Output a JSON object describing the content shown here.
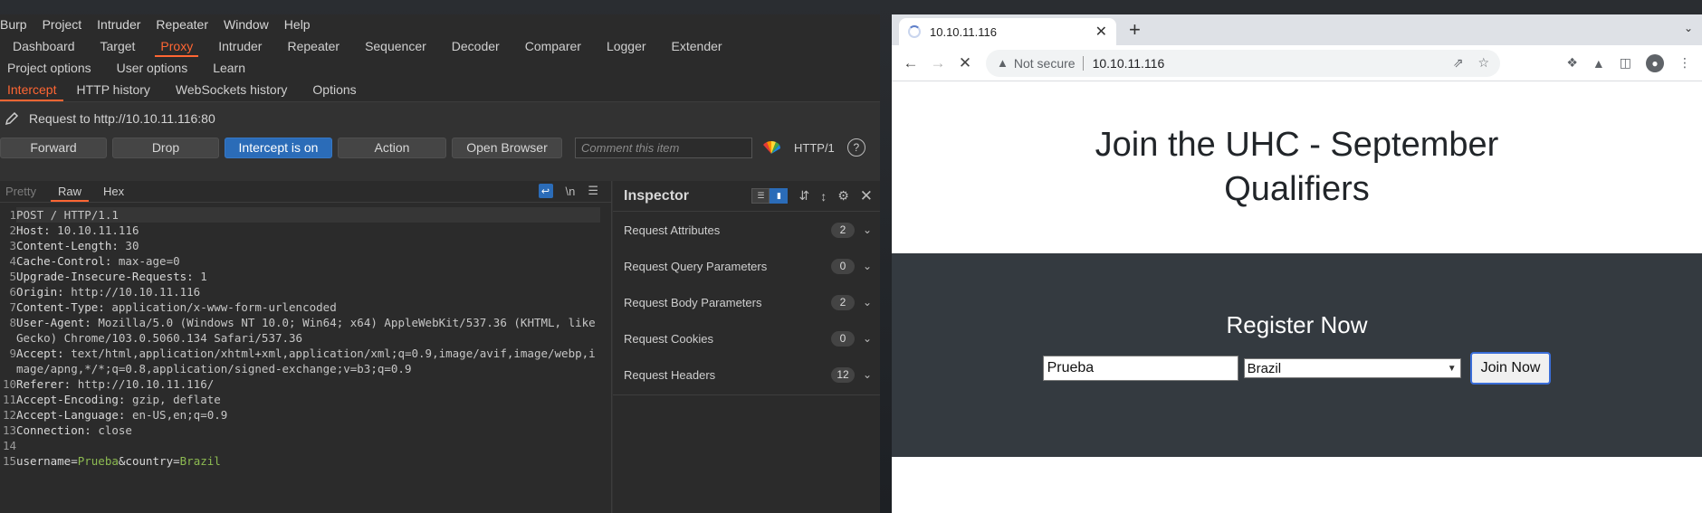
{
  "burp": {
    "menu": [
      "Burp",
      "Project",
      "Intruder",
      "Repeater",
      "Window",
      "Help"
    ],
    "tabs": [
      "Dashboard",
      "Target",
      "Proxy",
      "Intruder",
      "Repeater",
      "Sequencer",
      "Decoder",
      "Comparer",
      "Logger",
      "Extender"
    ],
    "tabs2": [
      "Project options",
      "User options",
      "Learn"
    ],
    "subtabs": [
      "Intercept",
      "HTTP history",
      "WebSockets history",
      "Options"
    ],
    "request_to": "Request to http://10.10.11.116:80",
    "buttons": {
      "forward": "Forward",
      "drop": "Drop",
      "intercept": "Intercept is on",
      "action": "Action",
      "open_browser": "Open Browser"
    },
    "comment_placeholder": "Comment this item",
    "http_version": "HTTP/1",
    "editor_tabs": [
      "Pretty",
      "Raw",
      "Hex"
    ],
    "newline_label": "\\n",
    "lines": [
      {
        "no": "1",
        "text": "POST / HTTP/1.1"
      },
      {
        "no": "2",
        "key": "Host:",
        "val": " 10.10.11.116"
      },
      {
        "no": "3",
        "key": "Content-Length:",
        "val": " 30"
      },
      {
        "no": "4",
        "key": "Cache-Control:",
        "val": " max-age=0"
      },
      {
        "no": "5",
        "key": "Upgrade-Insecure-Requests:",
        "val": " 1"
      },
      {
        "no": "6",
        "key": "Origin:",
        "val": " http://10.10.11.116"
      },
      {
        "no": "7",
        "key": "Content-Type:",
        "val": " application/x-www-form-urlencoded"
      },
      {
        "no": "8",
        "key": "User-Agent:",
        "val": " Mozilla/5.0 (Windows NT 10.0; Win64; x64) AppleWebKit/537.36 (KHTML, like Gecko) Chrome/103.0.5060.134 Safari/537.36"
      },
      {
        "no": "9",
        "key": "Accept:",
        "val": " text/html,application/xhtml+xml,application/xml;q=0.9,image/avif,image/webp,image/apng,*/*;q=0.8,application/signed-exchange;v=b3;q=0.9"
      },
      {
        "no": "10",
        "key": "Referer:",
        "val": " http://10.10.11.116/"
      },
      {
        "no": "11",
        "key": "Accept-Encoding:",
        "val": " gzip, deflate"
      },
      {
        "no": "12",
        "key": "Accept-Language:",
        "val": " en-US,en;q=0.9"
      },
      {
        "no": "13",
        "key": "Connection:",
        "val": " close"
      },
      {
        "no": "14",
        "text": ""
      }
    ],
    "body_line": {
      "no": "15",
      "p1": "username=",
      "v1": "Prueba",
      "amp": "&",
      "p2": "country=",
      "v2": "Brazil"
    },
    "inspector": {
      "title": "Inspector",
      "rows": [
        {
          "label": "Request Attributes",
          "count": "2"
        },
        {
          "label": "Request Query Parameters",
          "count": "0"
        },
        {
          "label": "Request Body Parameters",
          "count": "2"
        },
        {
          "label": "Request Cookies",
          "count": "0"
        },
        {
          "label": "Request Headers",
          "count": "12"
        }
      ]
    }
  },
  "chrome": {
    "tab_title": "10.10.11.116",
    "not_secure": "Not secure",
    "url": "10.10.11.116",
    "page": {
      "heading": "Join the UHC - September Qualifiers",
      "register_heading": "Register Now",
      "username_value": "Prueba",
      "country_value": "Brazil",
      "join_button": "Join Now"
    }
  }
}
